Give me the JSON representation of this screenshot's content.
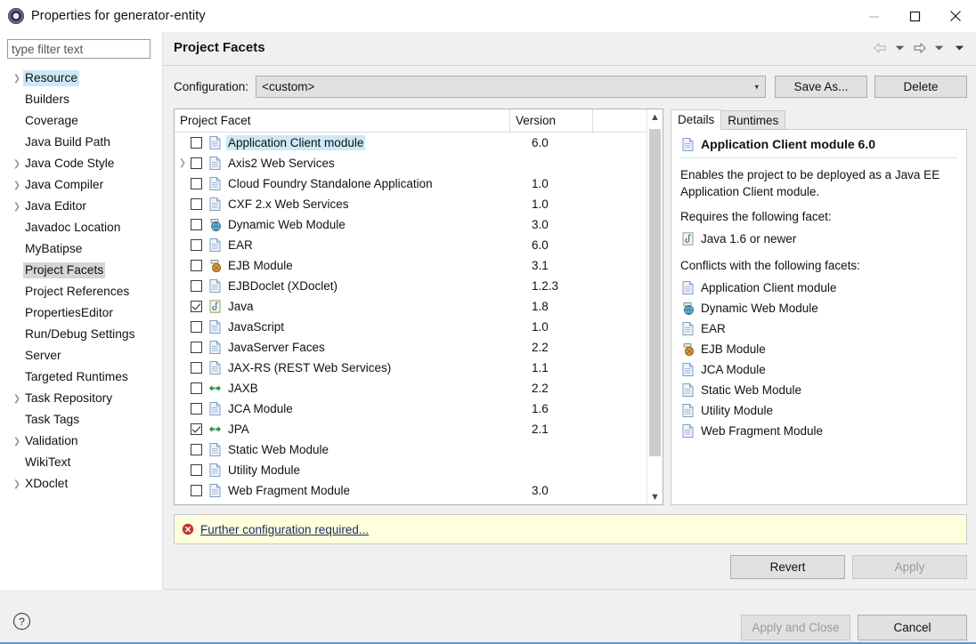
{
  "window": {
    "title": "Properties for generator-entity",
    "app_icon": "gear-icon",
    "minimize_label": "Minimize",
    "maximize_label": "Maximize",
    "close_label": "Close"
  },
  "sidebar": {
    "filter_placeholder": "type filter text",
    "filter_value": "",
    "items": [
      {
        "label": "Resource",
        "expandable": true,
        "selected": "blue"
      },
      {
        "label": "Builders",
        "expandable": false,
        "selected": "none"
      },
      {
        "label": "Coverage",
        "expandable": false,
        "selected": "none"
      },
      {
        "label": "Java Build Path",
        "expandable": false,
        "selected": "none"
      },
      {
        "label": "Java Code Style",
        "expandable": true,
        "selected": "none"
      },
      {
        "label": "Java Compiler",
        "expandable": true,
        "selected": "none"
      },
      {
        "label": "Java Editor",
        "expandable": true,
        "selected": "none"
      },
      {
        "label": "Javadoc Location",
        "expandable": false,
        "selected": "none"
      },
      {
        "label": "MyBatipse",
        "expandable": false,
        "selected": "none"
      },
      {
        "label": "Project Facets",
        "expandable": false,
        "selected": "gray"
      },
      {
        "label": "Project References",
        "expandable": false,
        "selected": "none"
      },
      {
        "label": "PropertiesEditor",
        "expandable": false,
        "selected": "none"
      },
      {
        "label": "Run/Debug Settings",
        "expandable": false,
        "selected": "none"
      },
      {
        "label": "Server",
        "expandable": false,
        "selected": "none"
      },
      {
        "label": "Targeted Runtimes",
        "expandable": false,
        "selected": "none"
      },
      {
        "label": "Task Repository",
        "expandable": true,
        "selected": "none"
      },
      {
        "label": "Task Tags",
        "expandable": false,
        "selected": "none"
      },
      {
        "label": "Validation",
        "expandable": true,
        "selected": "none"
      },
      {
        "label": "WikiText",
        "expandable": false,
        "selected": "none"
      },
      {
        "label": "XDoclet",
        "expandable": true,
        "selected": "none"
      }
    ]
  },
  "page": {
    "title": "Project Facets",
    "nav": {
      "back_icon": "arrow-left-icon",
      "back_menu_icon": "chevron-down-icon",
      "forward_icon": "arrow-right-icon",
      "forward_menu_icon": "chevron-down-icon",
      "view_menu_icon": "chevron-down-icon"
    }
  },
  "configuration": {
    "label": "Configuration:",
    "value": "<custom>",
    "dropdown_icon": "chevron-down-icon",
    "save_as_label": "Save As...",
    "delete_label": "Delete"
  },
  "facet_table": {
    "columns": [
      "Project Facet",
      "Version"
    ],
    "rows": [
      {
        "name": "Application Client module",
        "version": "6.0",
        "checked": false,
        "selected": true,
        "expandable": false,
        "icon": "document-icon",
        "has_version_dropdown": true
      },
      {
        "name": "Axis2 Web Services",
        "version": "",
        "checked": false,
        "selected": false,
        "expandable": true,
        "icon": "document-icon",
        "has_version_dropdown": false
      },
      {
        "name": "Cloud Foundry Standalone Application",
        "version": "1.0",
        "checked": false,
        "selected": false,
        "expandable": false,
        "icon": "document-icon",
        "has_version_dropdown": false
      },
      {
        "name": "CXF 2.x Web Services",
        "version": "1.0",
        "checked": false,
        "selected": false,
        "expandable": false,
        "icon": "document-icon",
        "has_version_dropdown": false
      },
      {
        "name": "Dynamic Web Module",
        "version": "3.0",
        "checked": false,
        "selected": false,
        "expandable": false,
        "icon": "web-module-icon",
        "has_version_dropdown": true
      },
      {
        "name": "EAR",
        "version": "6.0",
        "checked": false,
        "selected": false,
        "expandable": false,
        "icon": "document-icon",
        "has_version_dropdown": true
      },
      {
        "name": "EJB Module",
        "version": "3.1",
        "checked": false,
        "selected": false,
        "expandable": false,
        "icon": "ejb-module-icon",
        "has_version_dropdown": true
      },
      {
        "name": "EJBDoclet (XDoclet)",
        "version": "1.2.3",
        "checked": false,
        "selected": false,
        "expandable": false,
        "icon": "document-icon",
        "has_version_dropdown": true
      },
      {
        "name": "Java",
        "version": "1.8",
        "checked": true,
        "selected": false,
        "expandable": false,
        "icon": "java-icon",
        "has_version_dropdown": true
      },
      {
        "name": "JavaScript",
        "version": "1.0",
        "checked": false,
        "selected": false,
        "expandable": false,
        "icon": "document-icon",
        "has_version_dropdown": false
      },
      {
        "name": "JavaServer Faces",
        "version": "2.2",
        "checked": false,
        "selected": false,
        "expandable": false,
        "icon": "document-icon",
        "has_version_dropdown": true
      },
      {
        "name": "JAX-RS (REST Web Services)",
        "version": "1.1",
        "checked": false,
        "selected": false,
        "expandable": false,
        "icon": "document-icon",
        "has_version_dropdown": true
      },
      {
        "name": "JAXB",
        "version": "2.2",
        "checked": false,
        "selected": false,
        "expandable": false,
        "icon": "jaxb-icon",
        "has_version_dropdown": true
      },
      {
        "name": "JCA Module",
        "version": "1.6",
        "checked": false,
        "selected": false,
        "expandable": false,
        "icon": "document-icon",
        "has_version_dropdown": true
      },
      {
        "name": "JPA",
        "version": "2.1",
        "checked": true,
        "selected": false,
        "expandable": false,
        "icon": "jaxb-icon",
        "has_version_dropdown": true
      },
      {
        "name": "Static Web Module",
        "version": "",
        "checked": false,
        "selected": false,
        "expandable": false,
        "icon": "document-icon",
        "has_version_dropdown": false
      },
      {
        "name": "Utility Module",
        "version": "",
        "checked": false,
        "selected": false,
        "expandable": false,
        "icon": "document-icon",
        "has_version_dropdown": false
      },
      {
        "name": "Web Fragment Module",
        "version": "3.0",
        "checked": false,
        "selected": false,
        "expandable": false,
        "icon": "document-icon",
        "has_version_dropdown": true
      }
    ],
    "scrollbar": {
      "up_icon": "chevron-up-icon",
      "down_icon": "chevron-down-icon"
    }
  },
  "details": {
    "tabs": [
      {
        "label": "Details",
        "active": true
      },
      {
        "label": "Runtimes",
        "active": false
      }
    ],
    "title": "Application Client module 6.0",
    "title_icon": "document-icon",
    "description": "Enables the project to be deployed as a Java EE Application Client module.",
    "requires_heading": "Requires the following facet:",
    "requires": [
      {
        "label": "Java 1.6 or newer",
        "icon": "java-icon"
      }
    ],
    "conflicts_heading": "Conflicts with the following facets:",
    "conflicts": [
      {
        "label": "Application Client module",
        "icon": "document-icon"
      },
      {
        "label": "Dynamic Web Module",
        "icon": "web-module-icon"
      },
      {
        "label": "EAR",
        "icon": "document-icon"
      },
      {
        "label": "EJB Module",
        "icon": "ejb-module-icon"
      },
      {
        "label": "JCA Module",
        "icon": "document-icon"
      },
      {
        "label": "Static Web Module",
        "icon": "document-icon"
      },
      {
        "label": "Utility Module",
        "icon": "document-icon"
      },
      {
        "label": "Web Fragment Module",
        "icon": "document-icon"
      }
    ]
  },
  "warning": {
    "icon": "error-icon",
    "link_text": "Further configuration required...",
    "background": "#ffffdd",
    "link_color": "#1b2a5e"
  },
  "actions": {
    "revert_label": "Revert",
    "apply_label": "Apply",
    "apply_disabled": true
  },
  "footer": {
    "help_icon": "help-icon",
    "apply_and_close_label": "Apply and Close",
    "apply_and_close_disabled": true,
    "cancel_label": "Cancel"
  },
  "colors": {
    "selection_blue": "#cde8f6",
    "selection_gray": "#d6d6d6",
    "dialog_bg": "#f0f0f0",
    "warning_bg": "#ffffdd",
    "accent_bottom": "#5b9ad5"
  }
}
